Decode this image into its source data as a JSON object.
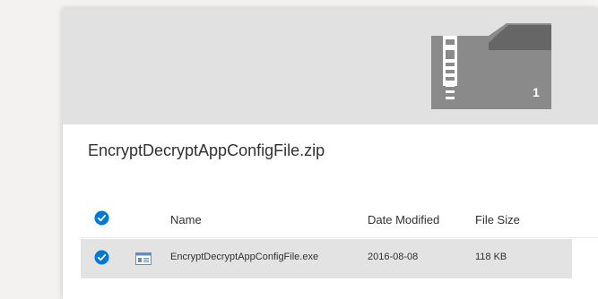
{
  "archive": {
    "file_name": "EncryptDecryptAppConfigFile.zip",
    "item_count": "1",
    "thumbnail_icon": "zip-archive-icon"
  },
  "table": {
    "columns": {
      "name": "Name",
      "date_modified": "Date Modified",
      "file_size": "File Size"
    },
    "select_all_checked": true,
    "rows": [
      {
        "selected": true,
        "type_icon": "application-file-icon",
        "name": "EncryptDecryptAppConfigFile.exe",
        "date_modified": "2016-08-08",
        "file_size": "118 KB"
      }
    ]
  },
  "colors": {
    "accent": "#0078d4",
    "hero_background": "#e1e1e1",
    "zip_art": "#8a8a8a",
    "selected_row": "#e3e3e3"
  }
}
